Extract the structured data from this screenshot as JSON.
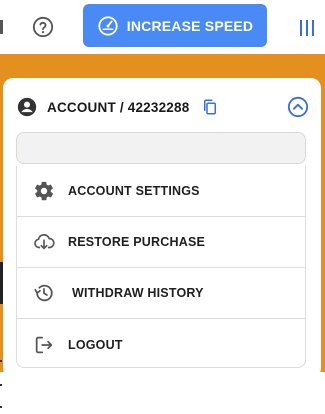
{
  "header": {
    "speed_button_label": "INCREASE SPEED",
    "icons": [
      "help-icon",
      "speedometer-icon",
      "menu-bars-icon"
    ],
    "accent_color": "#4a8af4"
  },
  "band_color": "#e3901f",
  "account": {
    "title": "ACCOUNT / 42232288",
    "icons": [
      "account-circle-icon",
      "copy-icon",
      "chevron-up-circle-icon"
    ]
  },
  "search": {
    "placeholder": ""
  },
  "menu": {
    "items": [
      {
        "label": "ACCOUNT SETTINGS",
        "icon": "gear-icon"
      },
      {
        "label": "RESTORE PURCHASE",
        "icon": "cloud-download-icon"
      },
      {
        "label": "WITHDRAW HISTORY",
        "icon": "history-icon"
      },
      {
        "label": "LOGOUT",
        "icon": "logout-icon"
      }
    ]
  }
}
